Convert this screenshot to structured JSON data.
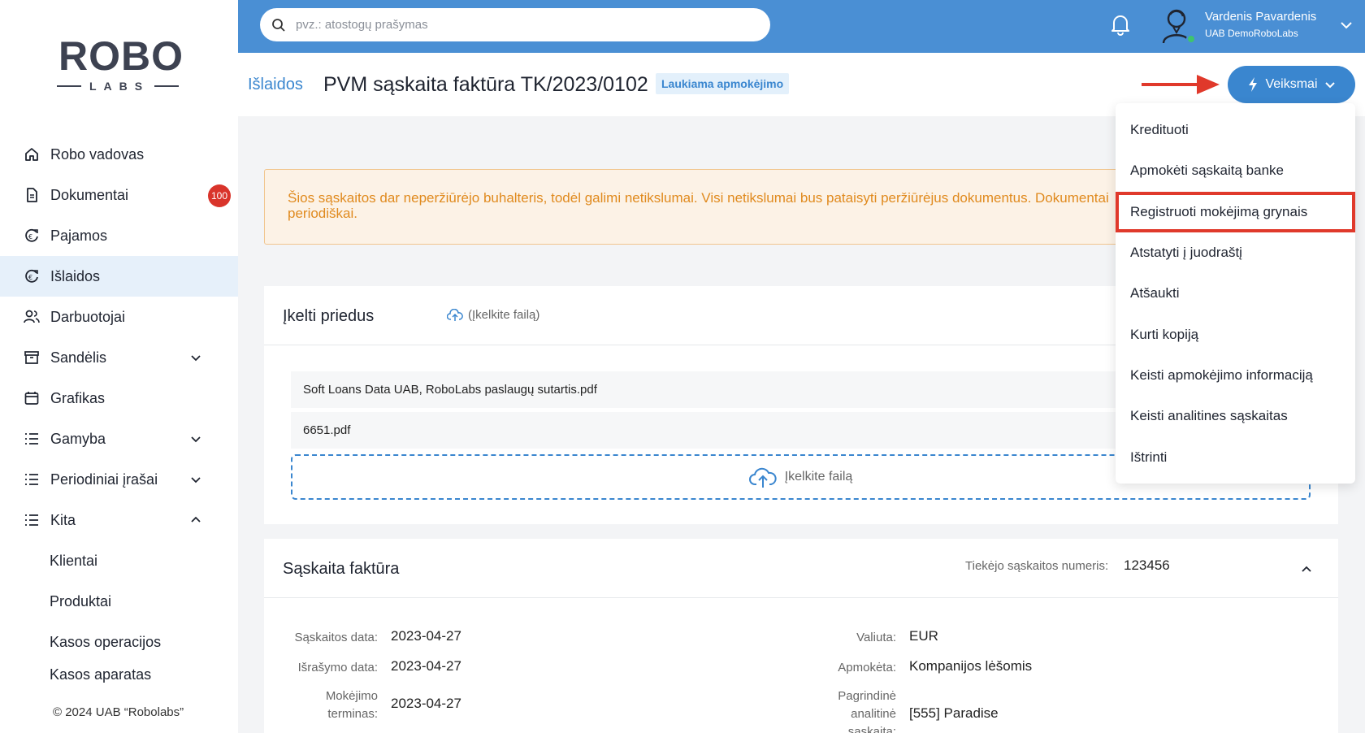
{
  "sidebar": {
    "logo": {
      "word": "ROBO",
      "sub": "LABS"
    },
    "items": [
      {
        "label": "Robo vadovas",
        "icon": "home-icon"
      },
      {
        "label": "Dokumentai",
        "icon": "document-icon",
        "badge": "100"
      },
      {
        "label": "Pajamos",
        "icon": "income-icon"
      },
      {
        "label": "Išlaidos",
        "icon": "expense-icon",
        "active": true
      },
      {
        "label": "Darbuotojai",
        "icon": "users-icon"
      },
      {
        "label": "Sandėlis",
        "icon": "warehouse-icon",
        "expandable": "down"
      },
      {
        "label": "Grafikas",
        "icon": "calendar-icon"
      },
      {
        "label": "Gamyba",
        "icon": "list-icon",
        "expandable": "down"
      },
      {
        "label": "Periodiniai įrašai",
        "icon": "list-icon",
        "expandable": "down"
      },
      {
        "label": "Kita",
        "icon": "list-icon",
        "expandable": "up"
      }
    ],
    "sub_items": [
      "Klientai",
      "Produktai",
      "Kasos operacijos",
      "Kasos aparatas"
    ],
    "copyright": "© 2024 UAB “Robolabs”"
  },
  "topbar": {
    "search_placeholder": "pvz.: atostogų prašymas",
    "user_name": "Vardenis Pavardenis",
    "user_company": "UAB DemoRoboLabs"
  },
  "header": {
    "breadcrumb": "Išlaidos",
    "title": "PVM sąskaita faktūra TK/2023/0102",
    "status": "Laukiama apmokėjimo",
    "actions_label": "Veiksmai"
  },
  "warning": {
    "line1": "Šios sąskaitos dar neperžiūrėjo buhalteris, todėl galimi netikslumai. Visi netikslumai bus pataisyti peržiūrėjus dokumentus. Dokumentai",
    "line2": "periodiškai."
  },
  "attachments": {
    "title": "Įkelti priedus",
    "upload_link": "(Įkelkite failą)",
    "files": [
      "Soft Loans Data UAB, RoboLabs paslaugų sutartis.pdf",
      "6651.pdf"
    ],
    "dropzone_label": "Įkelkite failą"
  },
  "invoice": {
    "title": "Sąskaita faktūra",
    "supplier_number_label": "Tiekėjo sąskaitos numeris:",
    "supplier_number": "123456",
    "fields_left": [
      {
        "label": "Sąskaitos data:",
        "value": "2023-04-27"
      },
      {
        "label": "Išrašymo data:",
        "value": "2023-04-27"
      },
      {
        "label": "Mokėjimo terminas:",
        "value": "2023-04-27"
      }
    ],
    "fields_right": [
      {
        "label": "Valiuta:",
        "value": "EUR"
      },
      {
        "label": "Apmokėta:",
        "value": "Kompanijos lėšomis"
      },
      {
        "label": "Pagrindinė analitinė sąskaita:",
        "value": "[555] Paradise"
      }
    ]
  },
  "menu": {
    "items": [
      "Kredituoti",
      "Apmokėti sąskaitą banke",
      "Registruoti mokėjimą grynais",
      "Atstatyti į juodraštį",
      "Atšaukti",
      "Kurti kopiją",
      "Keisti apmokėjimo informaciją",
      "Keisti analitines sąskaitas",
      "Ištrinti"
    ],
    "highlighted_index": 2
  },
  "colors": {
    "primary": "#3a86cf",
    "topbar": "#4a8fd4",
    "warning_text": "#e08a1e",
    "highlight": "#e0392b",
    "badge": "#d9342b"
  }
}
